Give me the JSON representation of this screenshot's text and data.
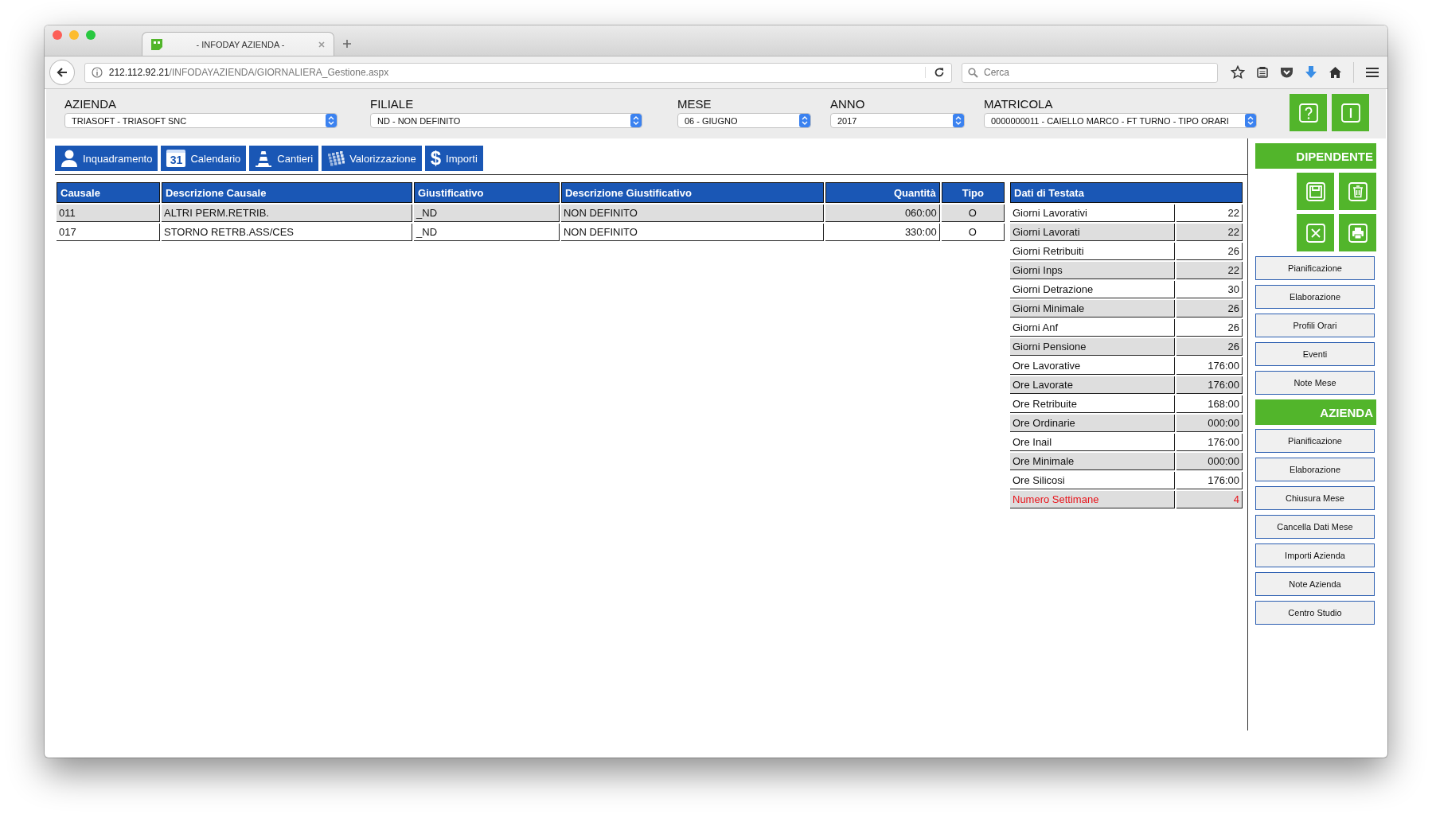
{
  "browser": {
    "tab_title": "- INFODAY AZIENDA -",
    "url_host": "212.112.92.21",
    "url_path": "/INFODAYAZIENDA/GIORNALIERA_Gestione.aspx",
    "search_placeholder": "Cerca"
  },
  "filters": [
    {
      "label": "AZIENDA",
      "value": "TRIASOFT - TRIASOFT SNC"
    },
    {
      "label": "FILIALE",
      "value": "ND - NON DEFINITO"
    },
    {
      "label": "MESE",
      "value": "06 - GIUGNO"
    },
    {
      "label": "ANNO",
      "value": "2017"
    },
    {
      "label": "MATRICOLA",
      "value": "0000000011 - CAIELLO MARCO - FT TURNO - TIPO ORARI"
    }
  ],
  "tabs": [
    {
      "label": "Inquadramento",
      "kind": "person"
    },
    {
      "label": "Calendario",
      "kind": "calendar",
      "glyph": "31"
    },
    {
      "label": "Cantieri",
      "kind": "cone"
    },
    {
      "label": "Valorizzazione",
      "kind": "cubes"
    },
    {
      "label": "Importi",
      "kind": "dollar",
      "glyph": "$"
    }
  ],
  "table": {
    "columns": [
      "Causale",
      "Descrizione Causale",
      "Giustificativo",
      "Descrizione Giustificativo",
      "Quantità",
      "Tipo"
    ],
    "rows": [
      [
        "011",
        "ALTRI PERM.RETRIB.",
        "_ND",
        "NON DEFINITO",
        "060:00",
        "O"
      ],
      [
        "017",
        "STORNO RETRB.ASS/CES",
        "_ND",
        "NON DEFINITO",
        "330:00",
        "O"
      ]
    ]
  },
  "testata": {
    "title": "Dati di Testata",
    "rows": [
      {
        "label": "Giorni Lavorativi",
        "value": "22",
        "alert": false
      },
      {
        "label": "Giorni Lavorati",
        "value": "22",
        "alert": false
      },
      {
        "label": "Giorni Retribuiti",
        "value": "26",
        "alert": false
      },
      {
        "label": "Giorni Inps",
        "value": "22",
        "alert": false
      },
      {
        "label": "Giorni Detrazione",
        "value": "30",
        "alert": false
      },
      {
        "label": "Giorni Minimale",
        "value": "26",
        "alert": false
      },
      {
        "label": "Giorni Anf",
        "value": "26",
        "alert": false
      },
      {
        "label": "Giorni Pensione",
        "value": "26",
        "alert": false
      },
      {
        "label": "Ore Lavorative",
        "value": "176:00",
        "alert": false
      },
      {
        "label": "Ore Lavorate",
        "value": "176:00",
        "alert": false
      },
      {
        "label": "Ore Retribuite",
        "value": "168:00",
        "alert": false
      },
      {
        "label": "Ore Ordinarie",
        "value": "000:00",
        "alert": false
      },
      {
        "label": "Ore Inail",
        "value": "176:00",
        "alert": false
      },
      {
        "label": "Ore Minimale",
        "value": "000:00",
        "alert": false
      },
      {
        "label": "Ore Silicosi",
        "value": "176:00",
        "alert": false
      },
      {
        "label": "Numero Settimane",
        "value": "4",
        "alert": true
      }
    ]
  },
  "sidebar": [
    {
      "title": "DIPENDENTE",
      "kind": "tools",
      "buttons": [
        "Pianificazione",
        "Elaborazione",
        "Profili Orari",
        "Eventi",
        "Note Mese"
      ]
    },
    {
      "title": "AZIENDA",
      "kind": "plain",
      "buttons": [
        "Pianificazione",
        "Elaborazione",
        "Chiusura Mese",
        "Cancella Dati Mese",
        "Importi Azienda",
        "Note Azienda",
        "Centro Studio"
      ]
    }
  ]
}
